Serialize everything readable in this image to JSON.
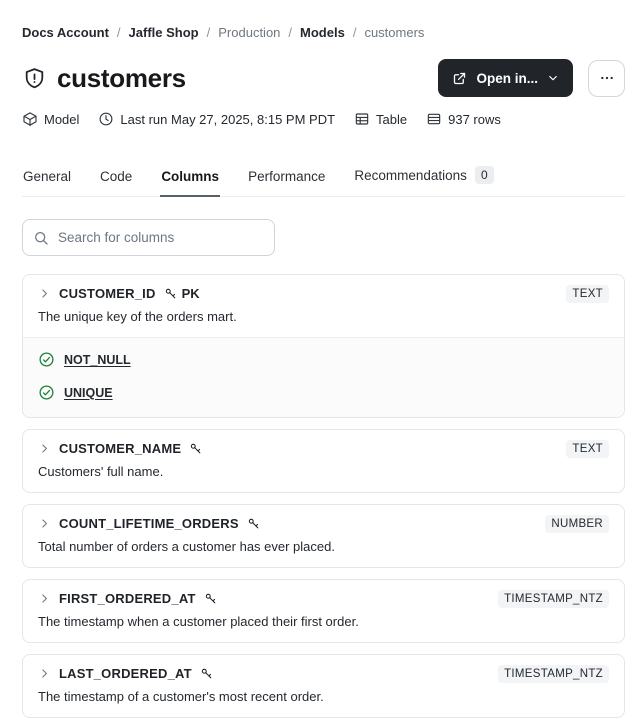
{
  "breadcrumb": {
    "separator": "/",
    "items": [
      {
        "label": "Docs Account",
        "style": "strong"
      },
      {
        "label": "Jaffle Shop",
        "style": "strong"
      },
      {
        "label": "Production",
        "style": "muted"
      },
      {
        "label": "Models",
        "style": "strong"
      },
      {
        "label": "customers",
        "style": "muted"
      }
    ]
  },
  "header": {
    "title": "customers",
    "title_icon": "shield-alert-icon",
    "open_in_button": {
      "label": "Open in..."
    },
    "more_button": {
      "icon": "ellipsis-icon"
    }
  },
  "meta": [
    {
      "icon": "package-icon",
      "label": "Model"
    },
    {
      "icon": "clock-icon",
      "label": "Last run May 27, 2025, 8:15 PM PDT"
    },
    {
      "icon": "table-icon",
      "label": "Table"
    },
    {
      "icon": "rows-icon",
      "label": "937 rows"
    }
  ],
  "tabs": [
    {
      "label": "General",
      "active": false
    },
    {
      "label": "Code",
      "active": false
    },
    {
      "label": "Columns",
      "active": true
    },
    {
      "label": "Performance",
      "active": false
    },
    {
      "label": "Recommendations",
      "active": false,
      "badge": "0"
    }
  ],
  "search": {
    "placeholder": "Search for columns",
    "value": ""
  },
  "columns": [
    {
      "name": "CUSTOMER_ID",
      "pk_label": "PK",
      "type": "TEXT",
      "description": "The unique key of the orders mart.",
      "tests": [
        {
          "label": "NOT_NULL"
        },
        {
          "label": "UNIQUE"
        }
      ]
    },
    {
      "name": "CUSTOMER_NAME",
      "type": "TEXT",
      "description": "Customers' full name.",
      "tests": []
    },
    {
      "name": "COUNT_LIFETIME_ORDERS",
      "type": "NUMBER",
      "description": "Total number of orders a customer has ever placed.",
      "tests": []
    },
    {
      "name": "FIRST_ORDERED_AT",
      "type": "TIMESTAMP_NTZ",
      "description": "The timestamp when a customer placed their first order.",
      "tests": []
    },
    {
      "name": "LAST_ORDERED_AT",
      "type": "TIMESTAMP_NTZ",
      "description": "The timestamp of a customer's most recent order.",
      "tests": []
    }
  ],
  "colors": {
    "primary_button_bg": "#212529",
    "test_pass_green": "#1a7f37",
    "type_badge_bg": "#f3f4f6",
    "card_border": "#e4e6ea"
  }
}
